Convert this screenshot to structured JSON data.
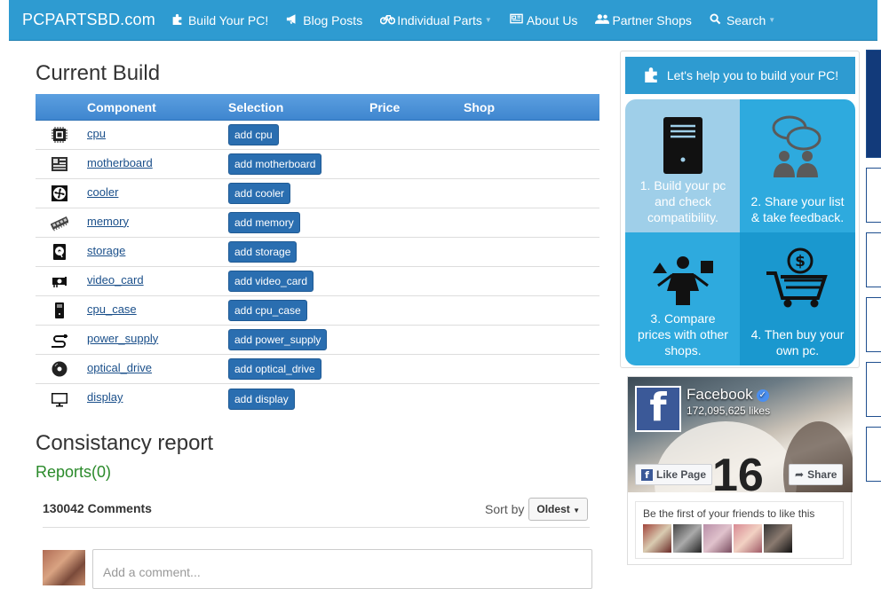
{
  "nav": {
    "brand": "PCPARTSBD.com",
    "items": [
      {
        "label": "Build Your PC!",
        "icon": "puzzle-icon",
        "caret": false
      },
      {
        "label": "Blog Posts",
        "icon": "bullhorn-icon",
        "caret": false
      },
      {
        "label": "Individual Parts",
        "icon": "bicycle-icon",
        "caret": true
      },
      {
        "label": "About Us",
        "icon": "newspaper-icon",
        "caret": false
      },
      {
        "label": "Partner Shops",
        "icon": "users-icon",
        "caret": false
      },
      {
        "label": "Search",
        "icon": "search-icon",
        "caret": true
      }
    ]
  },
  "build": {
    "title": "Current Build",
    "columns": [
      "Component",
      "Selection",
      "Price",
      "Shop"
    ],
    "rows": [
      {
        "component": "cpu",
        "button": "add cpu",
        "icon": "cpu-icon"
      },
      {
        "component": "motherboard",
        "button": "add motherboard",
        "icon": "motherboard-icon"
      },
      {
        "component": "cooler",
        "button": "add cooler",
        "icon": "fan-icon"
      },
      {
        "component": "memory",
        "button": "add memory",
        "icon": "ram-icon"
      },
      {
        "component": "storage",
        "button": "add storage",
        "icon": "hard-drive-icon"
      },
      {
        "component": "video_card",
        "button": "add video_card",
        "icon": "video-card-icon"
      },
      {
        "component": "cpu_case",
        "button": "add cpu_case",
        "icon": "tower-case-icon"
      },
      {
        "component": "power_supply",
        "button": "add power_supply",
        "icon": "power-plug-icon"
      },
      {
        "component": "optical_drive",
        "button": "add optical_drive",
        "icon": "disc-icon"
      },
      {
        "component": "display",
        "button": "add display",
        "icon": "monitor-icon"
      }
    ]
  },
  "report": {
    "title": "Consistancy report",
    "reports": "Reports(0)"
  },
  "comments": {
    "count": "130042 Comments",
    "sort_label": "Sort by",
    "sort_value": "Oldest",
    "placeholder": "Add a comment..."
  },
  "help": {
    "button": "Let's help you to build your PC!",
    "steps": [
      {
        "text": "1. Build your pc and check compatibility.",
        "color": "#9fcfe9",
        "icon": "computer-tower-icon"
      },
      {
        "text": "2. Share your list & take feedback.",
        "color": "#2eaade",
        "icon": "chat-people-icon"
      },
      {
        "text": "3. Compare prices with other shops.",
        "color": "#2eaade",
        "icon": "compare-person-icon"
      },
      {
        "text": "4. Then buy your own pc.",
        "color": "#1a98cf",
        "icon": "shopping-cart-dollar-icon"
      }
    ]
  },
  "facebook": {
    "name": "Facebook",
    "likes": "172,095,625 likes",
    "like_button": "Like Page",
    "share_button": "Share",
    "friends_text": "Be the first of your friends to like this"
  },
  "colors": {
    "nav": "#2e9bd1",
    "table_header": "#4a90d9",
    "button": "#2a6eb0",
    "reports": "#2a8a2a"
  }
}
